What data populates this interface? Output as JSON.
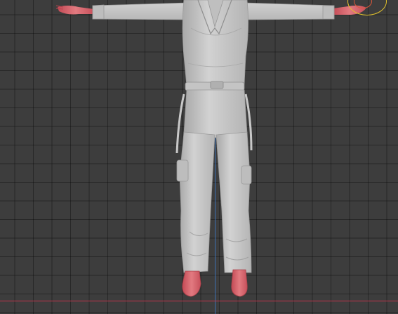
{
  "viewport": {
    "background": "#3d3d3d",
    "grid_color": "#2a2a2a",
    "x_axis_color": "#c4344a",
    "z_axis_color": "#3c6fb0",
    "gizmo_color": "#e3c32d"
  },
  "model": {
    "clothing_color": "#c9c9c9",
    "skin_color": "#d9606a",
    "pose": "t-pose"
  }
}
